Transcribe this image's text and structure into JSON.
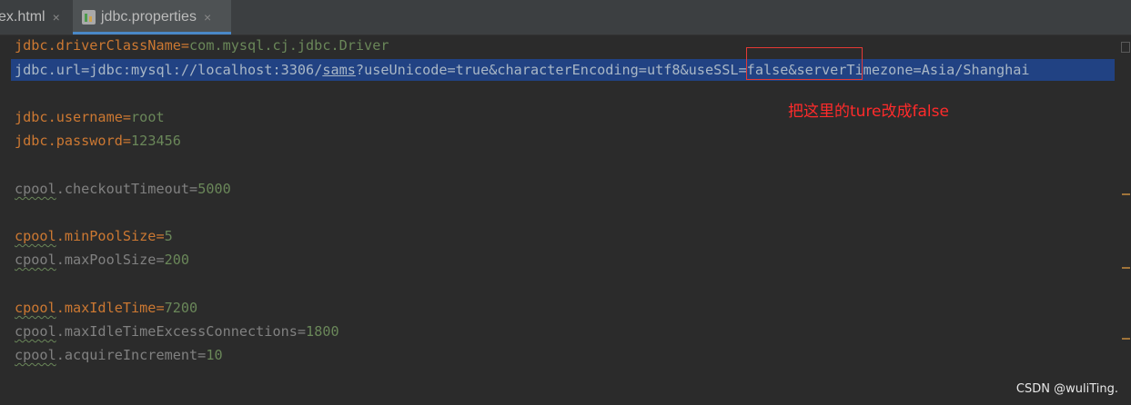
{
  "tabs": [
    {
      "label": "ex.html",
      "close": "×"
    },
    {
      "label": "jdbc.properties",
      "close": "×",
      "active": true
    }
  ],
  "editor": {
    "lines": {
      "l1": {
        "key": "jdbc.driverClassName",
        "eq": "=",
        "value": "com.mysql.cj.jdbc.Driver"
      },
      "l2": {
        "key": "jdbc.url",
        "eq": "=",
        "v1": "jdbc:mysql://localhost:3306/",
        "v2": "sams",
        "v3": "?useUnicode=true&characterEncoding=utf8&useSSL=false&serverTimezone=Asia/Shanghai"
      },
      "l4": {
        "key": "jdbc.username",
        "eq": "=",
        "value": "root"
      },
      "l5": {
        "key": "jdbc.password",
        "eq": "=",
        "value": "123456"
      },
      "l7": {
        "prefix": "cpool",
        "key": ".checkoutTimeout",
        "eq": "=",
        "value": "5000"
      },
      "l9": {
        "prefix": "cpool",
        "key": ".minPoolSize",
        "eq": "=",
        "value": "5"
      },
      "l10": {
        "prefix": "cpool",
        "key": ".maxPoolSize",
        "eq": "=",
        "value": "200"
      },
      "l12": {
        "prefix": "cpool",
        "key": ".maxIdleTime",
        "eq": "=",
        "value": "7200"
      },
      "l13": {
        "prefix": "cpool",
        "key": ".maxIdleTimeExcessConnections",
        "eq": "=",
        "value": "1800"
      },
      "l14": {
        "prefix": "cpool",
        "key": ".acquireIncrement",
        "eq": "=",
        "value": "10"
      }
    }
  },
  "annotation": {
    "text": "把这里的ture改成false"
  },
  "watermark": "CSDN @wuliTing.",
  "colors": {
    "annotation": "#ff2b2b",
    "selection": "#214283",
    "key": "#cc7832",
    "value": "#6a8759"
  },
  "icons": [
    "properties-file-icon",
    "close-icon"
  ]
}
